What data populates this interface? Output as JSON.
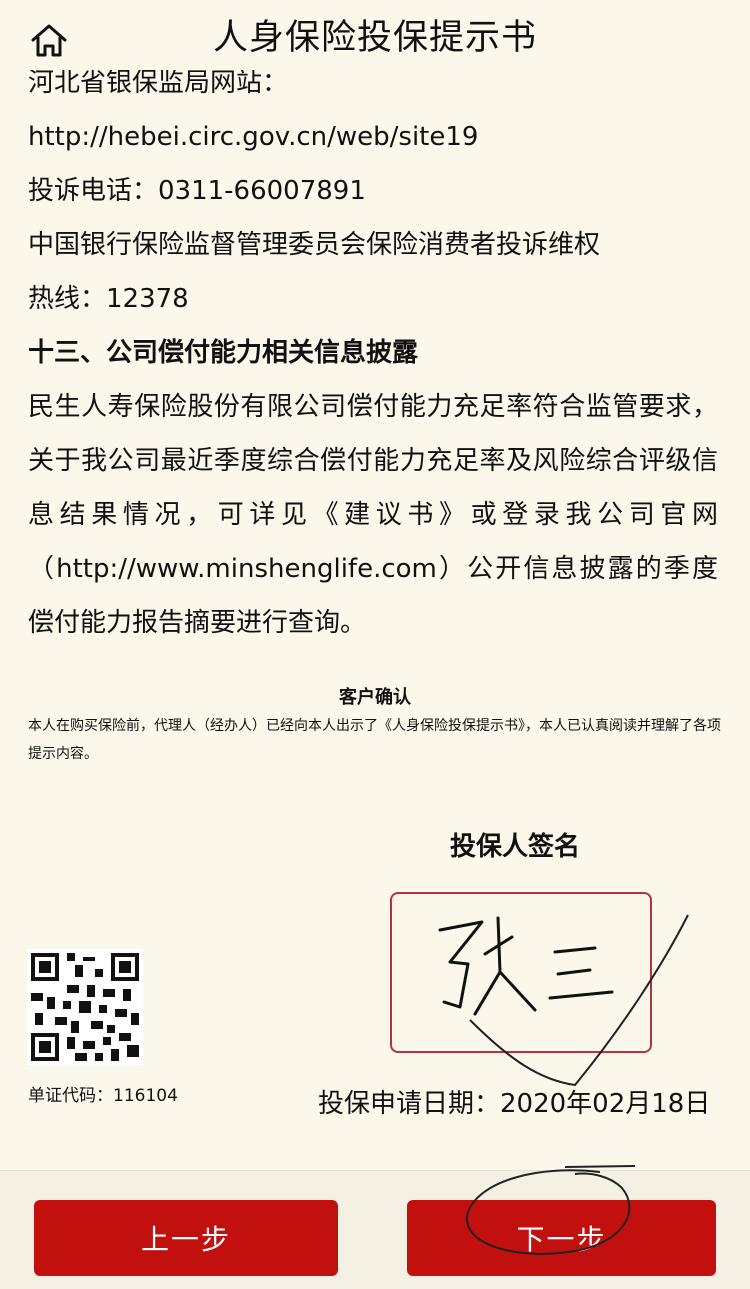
{
  "header": {
    "title": "人身保险投保提示书",
    "home_icon": "home-icon"
  },
  "content": {
    "clipped_line": "河北省银保监局网站：",
    "website": "http://hebei.circ.gov.cn/web/site19",
    "complaint_phone": "投诉电话：0311-66007891",
    "hotline_org": "中国银行保险监督管理委员会保险消费者投诉维权",
    "hotline": "热线：12378",
    "section_title": "十三、公司偿付能力相关信息披露",
    "section_text": "民生人寿保险股份有限公司偿付能力充足率符合监管要求，关于我公司最近季度综合偿付能力充足率及风险综合评级信息结果情况，可详见《建议书》或登录我公司官网（http://www.minshenglife.com）公开信息披露的季度偿付能力报告摘要进行查询。"
  },
  "confirmation": {
    "title": "客户确认",
    "text": "本人在购买保险前，代理人（经办人）已经向本人出示了《人身保险投保提示书》，本人已认真阅读并理解了各项提示内容。"
  },
  "signature": {
    "label": "投保人签名",
    "name": "张三"
  },
  "doc_code": "单证代码：116104",
  "date": "投保申请日期：2020年02月18日",
  "buttons": {
    "prev": "上一步",
    "next": "下一步"
  },
  "colors": {
    "background": "#fbf7ea",
    "accent": "#c2100f",
    "sign_border": "#b3343a"
  }
}
